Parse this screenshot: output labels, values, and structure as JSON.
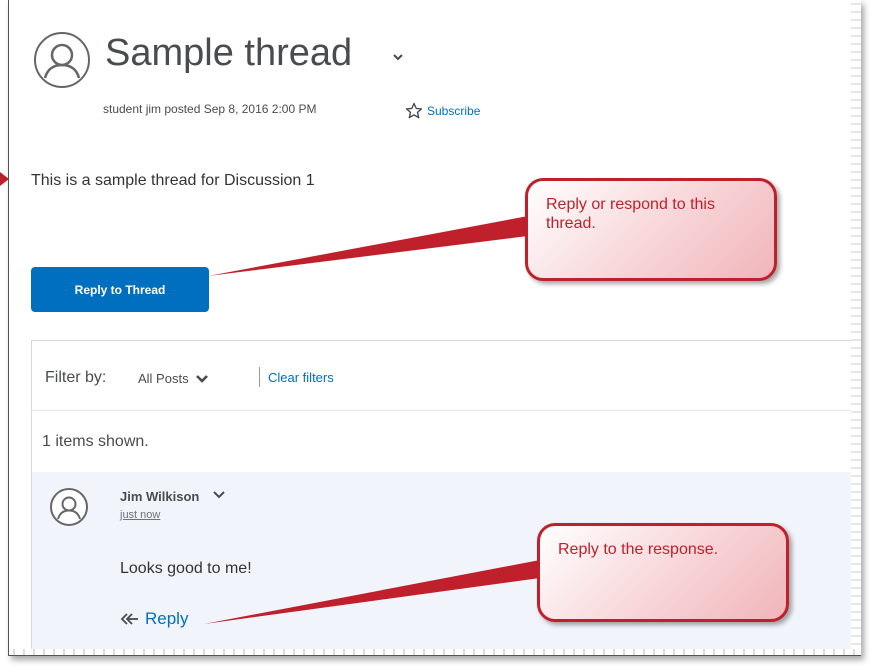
{
  "thread": {
    "title": "Sample thread",
    "meta": "student jim posted Sep 8, 2016 2:00 PM",
    "subscribe_label": "Subscribe",
    "body": "This is a sample thread for Discussion 1",
    "reply_button_label": "Reply to Thread"
  },
  "filter": {
    "label": "Filter by:",
    "selected": "All Posts",
    "clear_label": "Clear filters"
  },
  "count_text": "1 items shown.",
  "post": {
    "author": "Jim Wilkison",
    "time": "just now",
    "body": "Looks good to me!",
    "reply_label": "Reply"
  },
  "callouts": {
    "first": "Reply or respond to this thread.",
    "second": "Reply to the response."
  },
  "colors": {
    "link": "#006fbf",
    "button": "#006fbf",
    "callout_border": "#c0202c",
    "post_background": "#f1f5fb"
  }
}
